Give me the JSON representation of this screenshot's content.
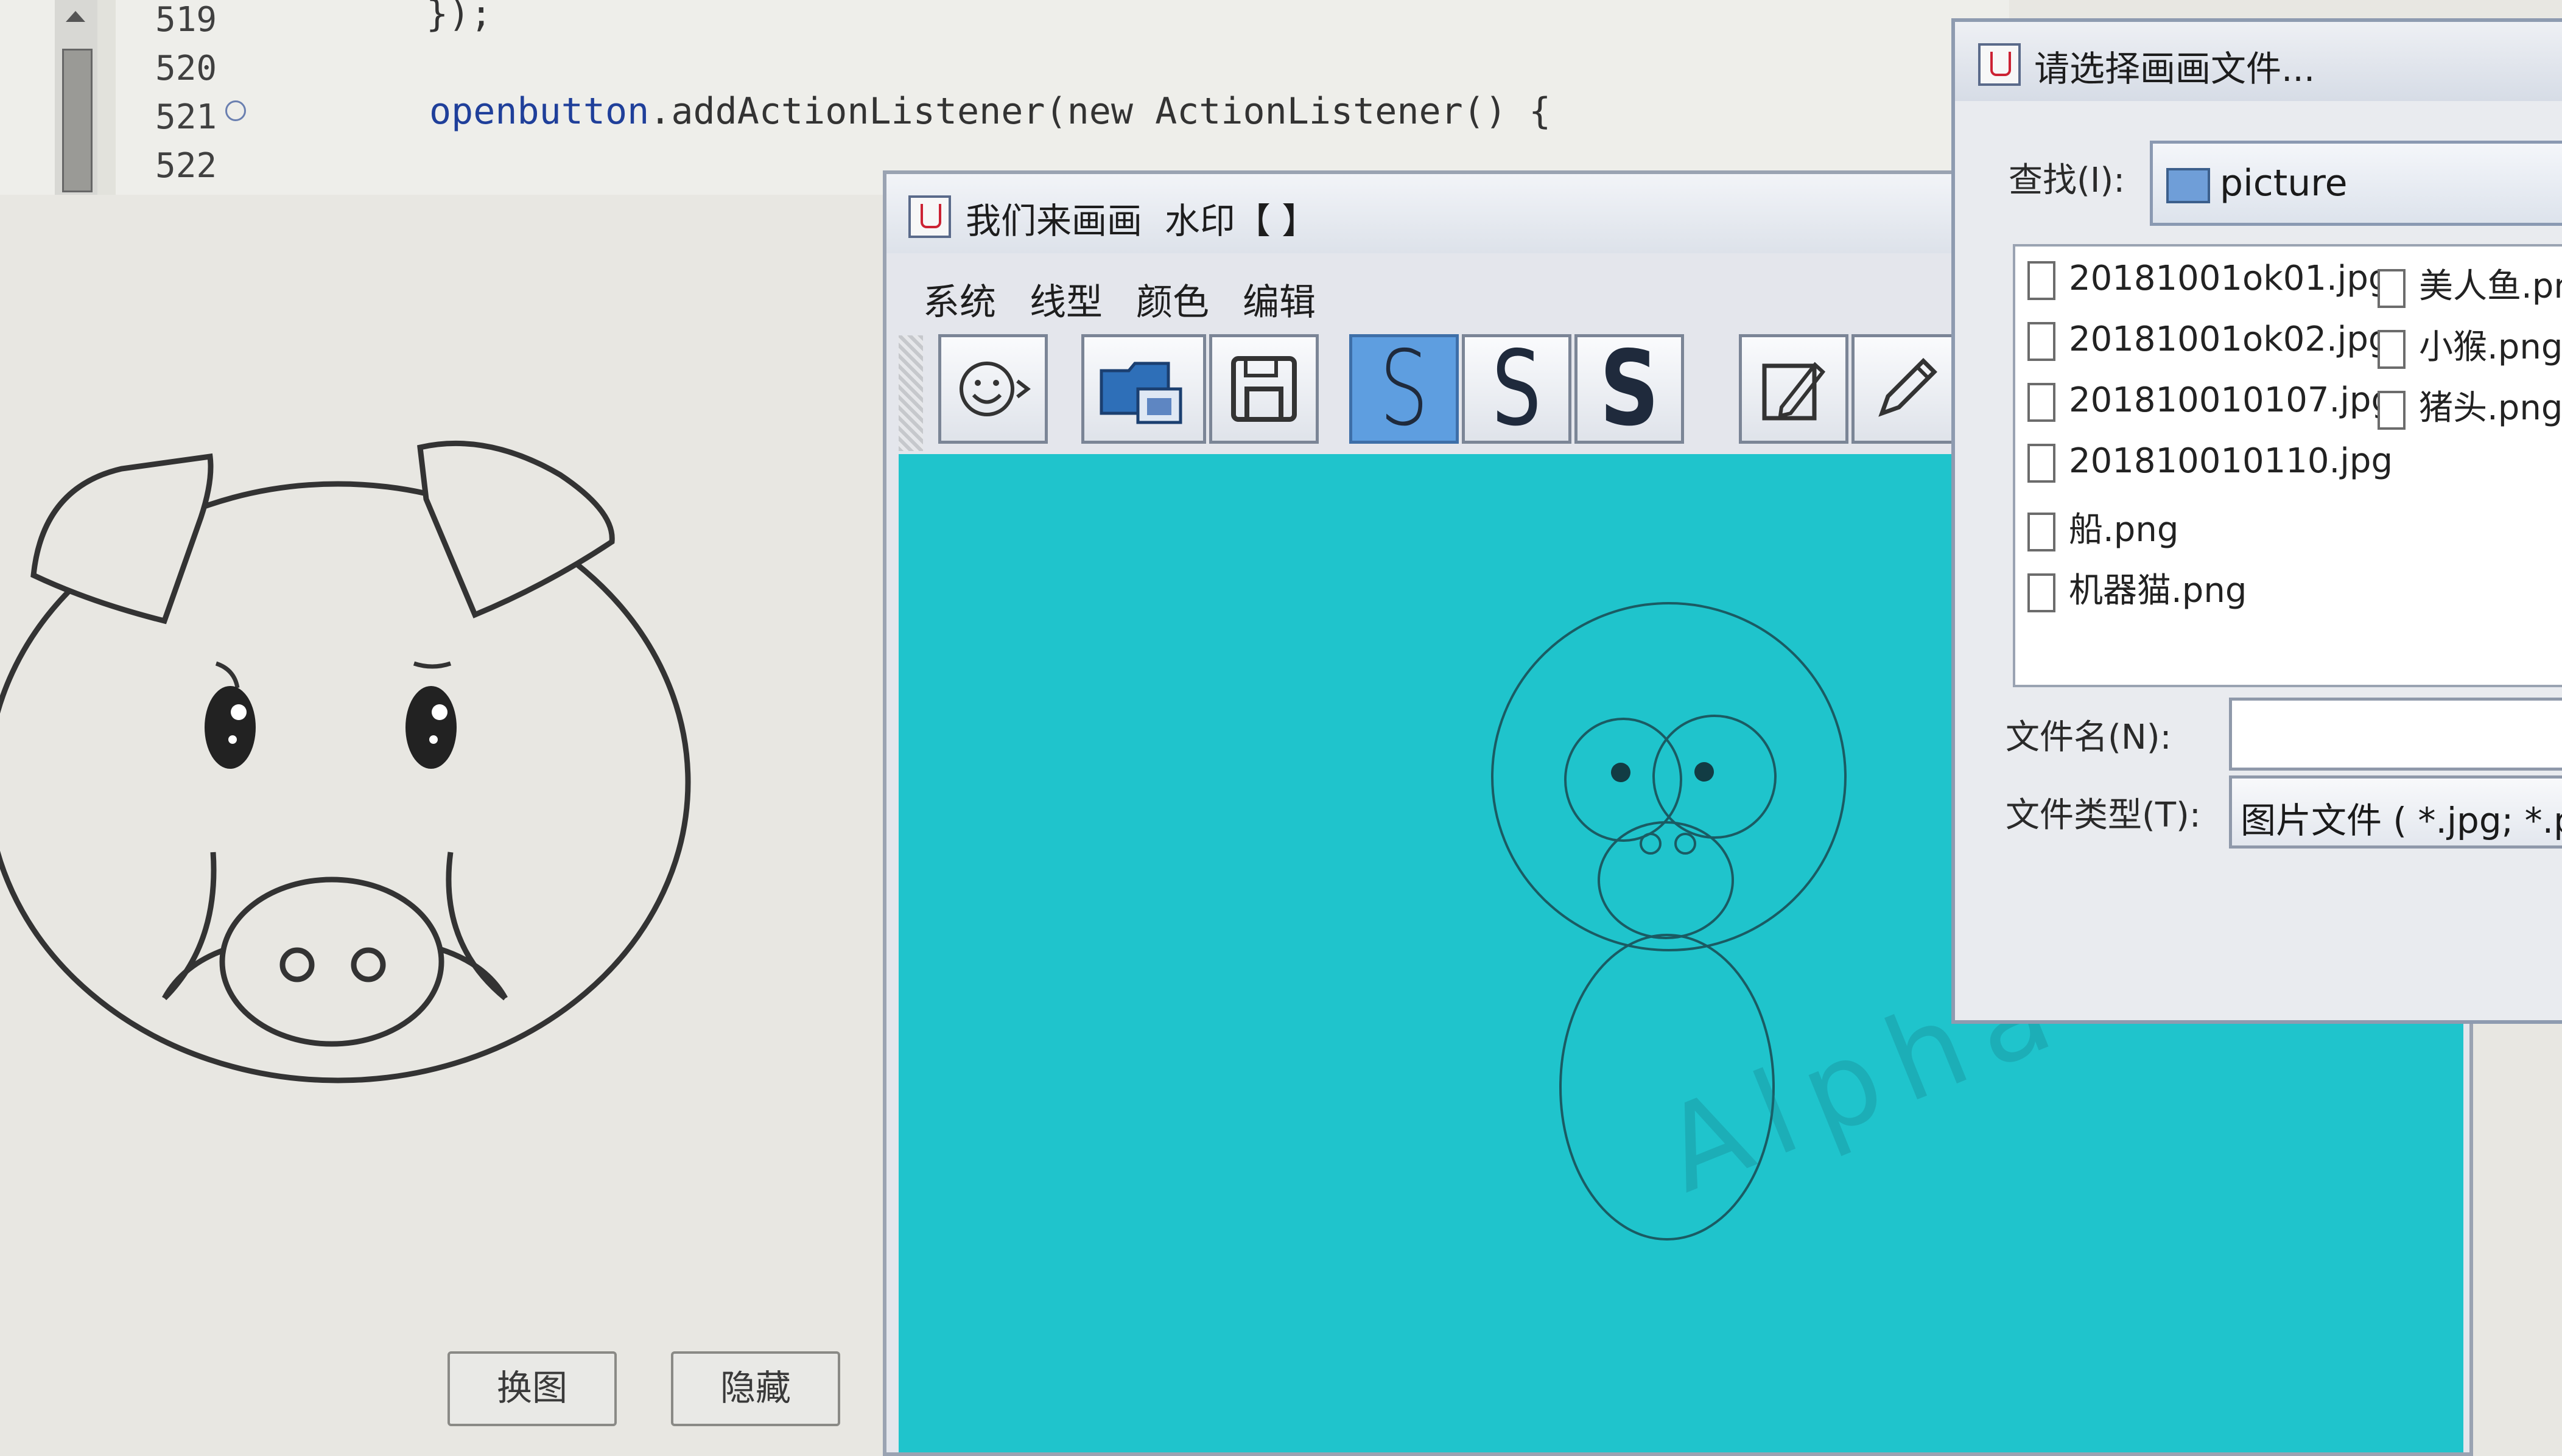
{
  "editor": {
    "line_numbers": [
      "519",
      "520",
      "521",
      "522"
    ],
    "line_519_code": "});",
    "line_521_object": "openbutton",
    "line_521_rest": ".addActionListener(new ActionListener() {"
  },
  "pig_panel": {
    "swap_button": "换图",
    "hide_button": "隐藏"
  },
  "draw_window": {
    "title": "我们来画画  水印【 】",
    "menus": [
      "系统",
      "线型",
      "颜色",
      "编辑"
    ],
    "tool_icons": [
      "smiley-icon",
      "open-folder-icon",
      "save-icon",
      "stroke-thin-icon",
      "stroke-medium-icon",
      "stroke-bold-icon",
      "edit-image-icon",
      "pencil-icon"
    ],
    "stroke_glyph": "S",
    "canvas_color": "#1fc4cc",
    "watermark": "Alpha 画师"
  },
  "file_chooser": {
    "title": "请选择画画文件...",
    "look_in_label": "查找(I):",
    "look_in_value": "picture",
    "files_col1": [
      "20181001ok01.jpg",
      "20181001ok02.jpg",
      "201810010107.jpg",
      "201810010110.jpg",
      "船.png",
      "机器猫.png"
    ],
    "files_col2": [
      "美人鱼.png",
      "小猴.png",
      "猪头.png"
    ],
    "file_name_label": "文件名(N):",
    "file_name_value": "",
    "file_type_label": "文件类型(T):",
    "file_type_value": "图片文件 ( *.jpg; *.png;"
  }
}
